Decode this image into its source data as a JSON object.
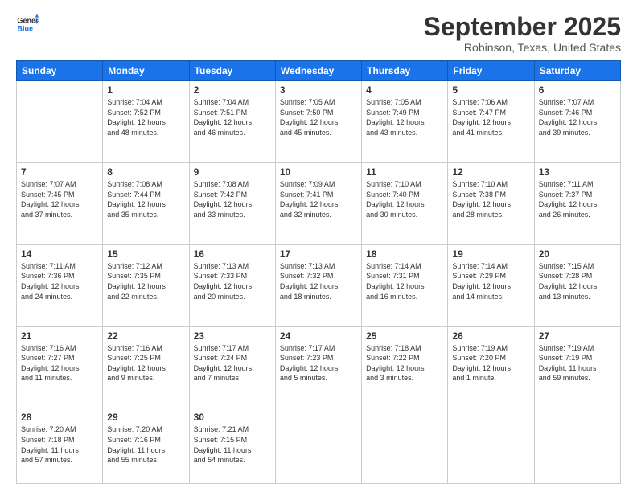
{
  "logo": {
    "line1": "General",
    "line2": "Blue"
  },
  "title": "September 2025",
  "subtitle": "Robinson, Texas, United States",
  "days_header": [
    "Sunday",
    "Monday",
    "Tuesday",
    "Wednesday",
    "Thursday",
    "Friday",
    "Saturday"
  ],
  "weeks": [
    [
      {
        "day": "",
        "info": ""
      },
      {
        "day": "1",
        "info": "Sunrise: 7:04 AM\nSunset: 7:52 PM\nDaylight: 12 hours\nand 48 minutes."
      },
      {
        "day": "2",
        "info": "Sunrise: 7:04 AM\nSunset: 7:51 PM\nDaylight: 12 hours\nand 46 minutes."
      },
      {
        "day": "3",
        "info": "Sunrise: 7:05 AM\nSunset: 7:50 PM\nDaylight: 12 hours\nand 45 minutes."
      },
      {
        "day": "4",
        "info": "Sunrise: 7:05 AM\nSunset: 7:49 PM\nDaylight: 12 hours\nand 43 minutes."
      },
      {
        "day": "5",
        "info": "Sunrise: 7:06 AM\nSunset: 7:47 PM\nDaylight: 12 hours\nand 41 minutes."
      },
      {
        "day": "6",
        "info": "Sunrise: 7:07 AM\nSunset: 7:46 PM\nDaylight: 12 hours\nand 39 minutes."
      }
    ],
    [
      {
        "day": "7",
        "info": "Sunrise: 7:07 AM\nSunset: 7:45 PM\nDaylight: 12 hours\nand 37 minutes."
      },
      {
        "day": "8",
        "info": "Sunrise: 7:08 AM\nSunset: 7:44 PM\nDaylight: 12 hours\nand 35 minutes."
      },
      {
        "day": "9",
        "info": "Sunrise: 7:08 AM\nSunset: 7:42 PM\nDaylight: 12 hours\nand 33 minutes."
      },
      {
        "day": "10",
        "info": "Sunrise: 7:09 AM\nSunset: 7:41 PM\nDaylight: 12 hours\nand 32 minutes."
      },
      {
        "day": "11",
        "info": "Sunrise: 7:10 AM\nSunset: 7:40 PM\nDaylight: 12 hours\nand 30 minutes."
      },
      {
        "day": "12",
        "info": "Sunrise: 7:10 AM\nSunset: 7:38 PM\nDaylight: 12 hours\nand 28 minutes."
      },
      {
        "day": "13",
        "info": "Sunrise: 7:11 AM\nSunset: 7:37 PM\nDaylight: 12 hours\nand 26 minutes."
      }
    ],
    [
      {
        "day": "14",
        "info": "Sunrise: 7:11 AM\nSunset: 7:36 PM\nDaylight: 12 hours\nand 24 minutes."
      },
      {
        "day": "15",
        "info": "Sunrise: 7:12 AM\nSunset: 7:35 PM\nDaylight: 12 hours\nand 22 minutes."
      },
      {
        "day": "16",
        "info": "Sunrise: 7:13 AM\nSunset: 7:33 PM\nDaylight: 12 hours\nand 20 minutes."
      },
      {
        "day": "17",
        "info": "Sunrise: 7:13 AM\nSunset: 7:32 PM\nDaylight: 12 hours\nand 18 minutes."
      },
      {
        "day": "18",
        "info": "Sunrise: 7:14 AM\nSunset: 7:31 PM\nDaylight: 12 hours\nand 16 minutes."
      },
      {
        "day": "19",
        "info": "Sunrise: 7:14 AM\nSunset: 7:29 PM\nDaylight: 12 hours\nand 14 minutes."
      },
      {
        "day": "20",
        "info": "Sunrise: 7:15 AM\nSunset: 7:28 PM\nDaylight: 12 hours\nand 13 minutes."
      }
    ],
    [
      {
        "day": "21",
        "info": "Sunrise: 7:16 AM\nSunset: 7:27 PM\nDaylight: 12 hours\nand 11 minutes."
      },
      {
        "day": "22",
        "info": "Sunrise: 7:16 AM\nSunset: 7:25 PM\nDaylight: 12 hours\nand 9 minutes."
      },
      {
        "day": "23",
        "info": "Sunrise: 7:17 AM\nSunset: 7:24 PM\nDaylight: 12 hours\nand 7 minutes."
      },
      {
        "day": "24",
        "info": "Sunrise: 7:17 AM\nSunset: 7:23 PM\nDaylight: 12 hours\nand 5 minutes."
      },
      {
        "day": "25",
        "info": "Sunrise: 7:18 AM\nSunset: 7:22 PM\nDaylight: 12 hours\nand 3 minutes."
      },
      {
        "day": "26",
        "info": "Sunrise: 7:19 AM\nSunset: 7:20 PM\nDaylight: 12 hours\nand 1 minute."
      },
      {
        "day": "27",
        "info": "Sunrise: 7:19 AM\nSunset: 7:19 PM\nDaylight: 11 hours\nand 59 minutes."
      }
    ],
    [
      {
        "day": "28",
        "info": "Sunrise: 7:20 AM\nSunset: 7:18 PM\nDaylight: 11 hours\nand 57 minutes."
      },
      {
        "day": "29",
        "info": "Sunrise: 7:20 AM\nSunset: 7:16 PM\nDaylight: 11 hours\nand 55 minutes."
      },
      {
        "day": "30",
        "info": "Sunrise: 7:21 AM\nSunset: 7:15 PM\nDaylight: 11 hours\nand 54 minutes."
      },
      {
        "day": "",
        "info": ""
      },
      {
        "day": "",
        "info": ""
      },
      {
        "day": "",
        "info": ""
      },
      {
        "day": "",
        "info": ""
      }
    ]
  ]
}
